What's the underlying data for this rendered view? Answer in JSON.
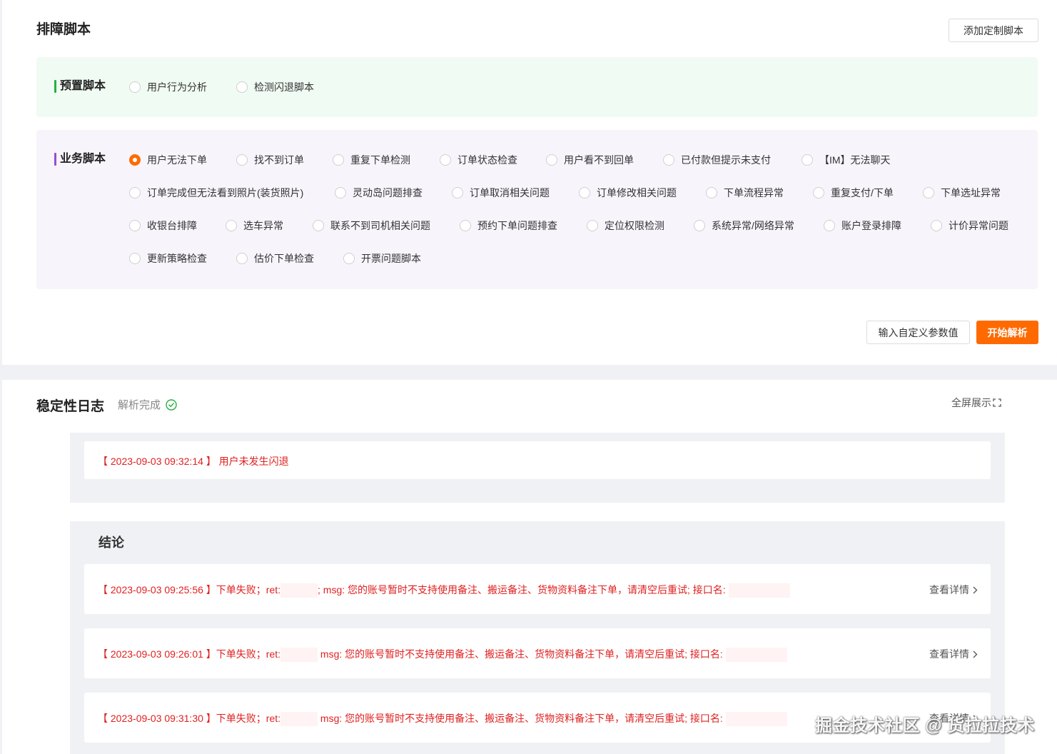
{
  "scripts_panel": {
    "title": "排障脚本",
    "add_button": "添加定制脚本",
    "preset": {
      "label": "预置脚本",
      "options": [
        "用户行为分析",
        "检测闪退脚本"
      ]
    },
    "business": {
      "label": "业务脚本",
      "selected": "用户无法下单",
      "rows": [
        [
          "用户无法下单",
          "找不到订单",
          "重复下单检测",
          "订单状态检查",
          "用户看不到回单",
          "已付款但提示未支付",
          "【IM】无法聊天"
        ],
        [
          "订单完成但无法看到照片(装货照片)",
          "灵动岛问题排查",
          "订单取消相关问题",
          "订单修改相关问题",
          "下单流程异常",
          "重复支付/下单",
          "下单选址异常"
        ],
        [
          "收银台排障",
          "选车异常",
          "联系不到司机相关问题",
          "预约下单问题排查",
          "定位权限检测",
          "系统异常/网络异常",
          "账户登录排障",
          "计价异常问题"
        ],
        [
          "更新策略检查",
          "估价下单检查",
          "开票问题脚本"
        ]
      ]
    },
    "custom_param_button": "输入自定义参数值",
    "start_button": "开始解析"
  },
  "log_panel": {
    "title": "稳定性日志",
    "status": "解析完成",
    "fullscreen": "全屏展示",
    "summary": {
      "timestamp": "【 2023-09-03 09:32:14 】",
      "message": "用户未发生闪退"
    },
    "conclusion": {
      "title": "结论",
      "detail_label": "查看详情",
      "entries": [
        {
          "timestamp": "【 2023-09-03 09:25:56 】",
          "prefix": "下单失败；ret:",
          "sep": "; ",
          "msg": "msg: 您的账号暂时不支持使用备注、搬运备注、货物资料备注下单，请清空后重试; 接口名:"
        },
        {
          "timestamp": "【 2023-09-03 09:26:01 】",
          "prefix": "下单失败；ret:",
          "sep": " ",
          "msg": "msg: 您的账号暂时不支持使用备注、搬运备注、货物资料备注下单，请清空后重试; 接口名:"
        },
        {
          "timestamp": "【 2023-09-03 09:31:30 】",
          "prefix": "下单失败；ret:",
          "sep": " ",
          "msg": "msg: 您的账号暂时不支持使用备注、搬运备注、货物资料备注下单，请清空后重试; 接口名:"
        }
      ]
    }
  },
  "watermark": "掘金技术社区 @ 货拉拉技术",
  "colors": {
    "accent": "#ff6a00",
    "error_text": "#e02020",
    "preset_bar": "#27b043",
    "business_bar": "#9a4fc8",
    "success": "#27b043"
  }
}
